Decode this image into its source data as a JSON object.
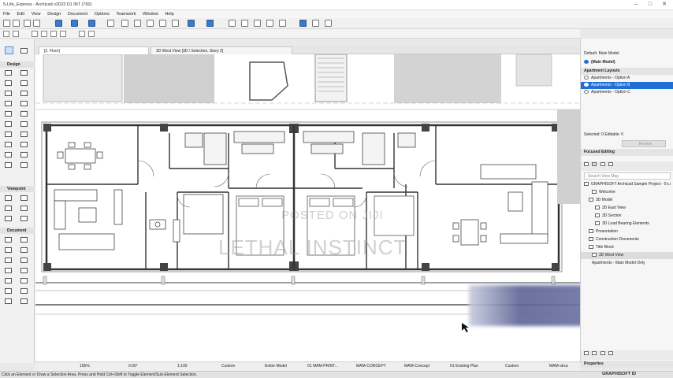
{
  "window": {
    "title": "5-Life_Express - Archicad v2023 D1 INT (760)"
  },
  "menu": [
    "File",
    "Edit",
    "View",
    "Design",
    "Document",
    "Options",
    "Teamwork",
    "Window",
    "Help"
  ],
  "toolbox": {
    "sections": [
      "Design",
      "Viewpoint",
      "Document"
    ]
  },
  "tabs": [
    {
      "label": "[2. Floor]"
    },
    {
      "label": "3D West View [3D / Selection, Story 2]"
    }
  ],
  "canvas": {
    "watermark_1": "POSTED ON JIJI",
    "watermark_2": "LETHAL INSTINCT"
  },
  "right_panel": {
    "header": "Default: Main Model",
    "main_model": "(Main Model)",
    "layouts_group": "Apartment Layouts",
    "options": [
      "Apartments - Option A",
      "Apartments - Option B",
      "Apartments - Option C"
    ],
    "selected_option_index": 1,
    "selection_info": "Selected: 0 Editable: 0",
    "review_button": "Review",
    "focused_editing": "Focused Editing",
    "search_placeholder": "Search View Map",
    "tree": [
      "GRAPHISOFT Archicad Sample Project - 5-Li",
      "Welcome",
      "3D Model",
      "3D East View",
      "3D Section",
      "3D Load Bearing Elements",
      "Presentation",
      "Construction Documents",
      "Title Block",
      "3D West View",
      "Apartments - Main Model Only"
    ],
    "properties": "Properties"
  },
  "statusbar": {
    "zoom": "155%",
    "angle": "0.00°",
    "scale": "1:100",
    "custom1": "Custom",
    "model": "Entire Model",
    "layer": "01 MAM-PRINT...",
    "concept": "MAM-CONCEPT",
    "concept2": "MAM-Concept",
    "plan": "01 Existing Plan",
    "custom2": "Custom",
    "struct": "MAM-struc"
  },
  "hint": "Click an Element or Draw a Selection Area, Press and Hold Ctrl+Shift to Toggle Element/Sub-Element Selection.",
  "brand": "GRAPHISOFT ID"
}
